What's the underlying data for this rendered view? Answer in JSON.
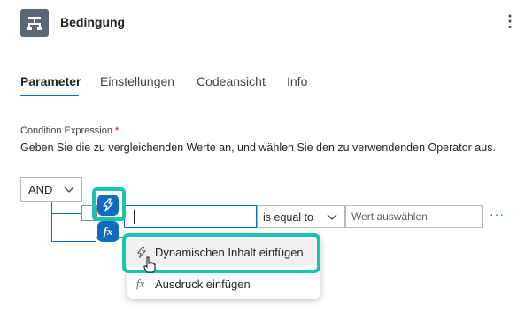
{
  "header": {
    "title": "Bedingung",
    "icon": "condition-icon",
    "more_icon": "more-vertical-icon"
  },
  "tabs": [
    {
      "label": "Parameter",
      "active": true
    },
    {
      "label": "Einstellungen",
      "active": false
    },
    {
      "label": "Codeansicht",
      "active": false
    },
    {
      "label": "Info",
      "active": false
    }
  ],
  "condition": {
    "label": "Condition Expression",
    "required_mark": "*",
    "help": "Geben Sie die zu vergleichenden Werte an, und wählen Sie den zu verwendenden Operator aus.",
    "group_operator": "AND",
    "row": {
      "left_value": "",
      "operator": "is equal to",
      "right_placeholder": "Wert auswählen",
      "more": "···"
    }
  },
  "flyout": {
    "items": [
      {
        "label": "Dynamischen Inhalt einfügen",
        "icon": "lightning-icon",
        "glyph": "⚡"
      },
      {
        "label": "Ausdruck einfügen",
        "icon": "fx-icon",
        "glyph": "fx"
      }
    ]
  },
  "buttons": {
    "expression_glyph": "fx"
  },
  "colors": {
    "accent": "#0f6cbd",
    "highlight": "#19c3b2",
    "required": "#c50f1f"
  }
}
